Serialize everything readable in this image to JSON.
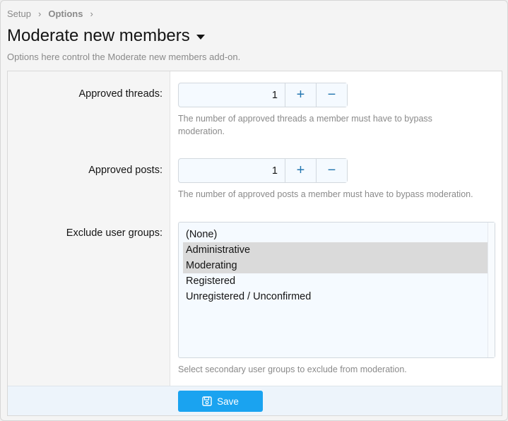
{
  "breadcrumb": {
    "items": [
      "Setup",
      "Options"
    ],
    "separator": "›"
  },
  "page": {
    "title": "Moderate new members",
    "description": "Options here control the Moderate new members add-on."
  },
  "options": {
    "approved_threads": {
      "label": "Approved threads:",
      "value": "1",
      "plus": "+",
      "minus": "−",
      "hint_line1": "The number of approved threads a member must have to bypass",
      "hint_line2": "moderation."
    },
    "approved_posts": {
      "label": "Approved posts:",
      "value": "1",
      "plus": "+",
      "minus": "−",
      "hint": "The number of approved posts a member must have to bypass moderation."
    },
    "exclude_groups": {
      "label": "Exclude user groups:",
      "items": [
        {
          "label": "(None)",
          "selected": false
        },
        {
          "label": "Administrative",
          "selected": true
        },
        {
          "label": "Moderating",
          "selected": true
        },
        {
          "label": "Registered",
          "selected": false
        },
        {
          "label": "Unregistered / Unconfirmed",
          "selected": false
        }
      ],
      "hint": "Select secondary user groups to exclude from moderation."
    }
  },
  "footer": {
    "save_label": "Save"
  },
  "colors": {
    "accent": "#1aa3f0",
    "link": "#2577b1",
    "muted_text": "#8a8a8a",
    "selected_bg": "#dadada"
  },
  "icons": {
    "save": "floppy-disk-icon",
    "title_caret": "caret-down-icon",
    "breadcrumb_separator": "chevron-right-icon"
  }
}
